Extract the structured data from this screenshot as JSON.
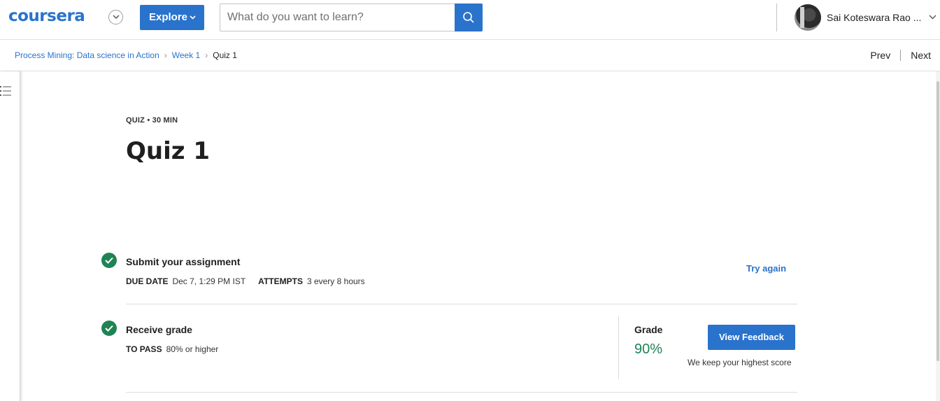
{
  "header": {
    "logo_text": "coursera",
    "explore_label": "Explore",
    "search": {
      "placeholder": "What do you want to learn?",
      "value": ""
    },
    "user_name": "Sai Koteswara Rao ..."
  },
  "breadcrumb": {
    "items": [
      "Process Mining: Data science in Action",
      "Week 1",
      "Quiz 1"
    ],
    "prev_label": "Prev",
    "next_label": "Next"
  },
  "quiz": {
    "eyebrow": "QUIZ • 30 MIN",
    "title": "Quiz 1"
  },
  "submit": {
    "title": "Submit your assignment",
    "due_label": "DUE DATE",
    "due_value": "Dec 7, 1:29 PM IST",
    "attempts_label": "ATTEMPTS",
    "attempts_value": "3 every 8 hours",
    "action_label": "Try again"
  },
  "grade": {
    "title": "Receive grade",
    "pass_label": "TO PASS",
    "pass_value": "80% or higher",
    "grade_label": "Grade",
    "grade_value": "90%",
    "button_label": "View Feedback",
    "note": "We keep your highest score"
  },
  "colors": {
    "brand_blue": "#2a73cc",
    "success_green": "#1f8354"
  },
  "icons": [
    "chevron-down-icon",
    "search-icon",
    "menu-list-icon",
    "check-circle-icon"
  ]
}
